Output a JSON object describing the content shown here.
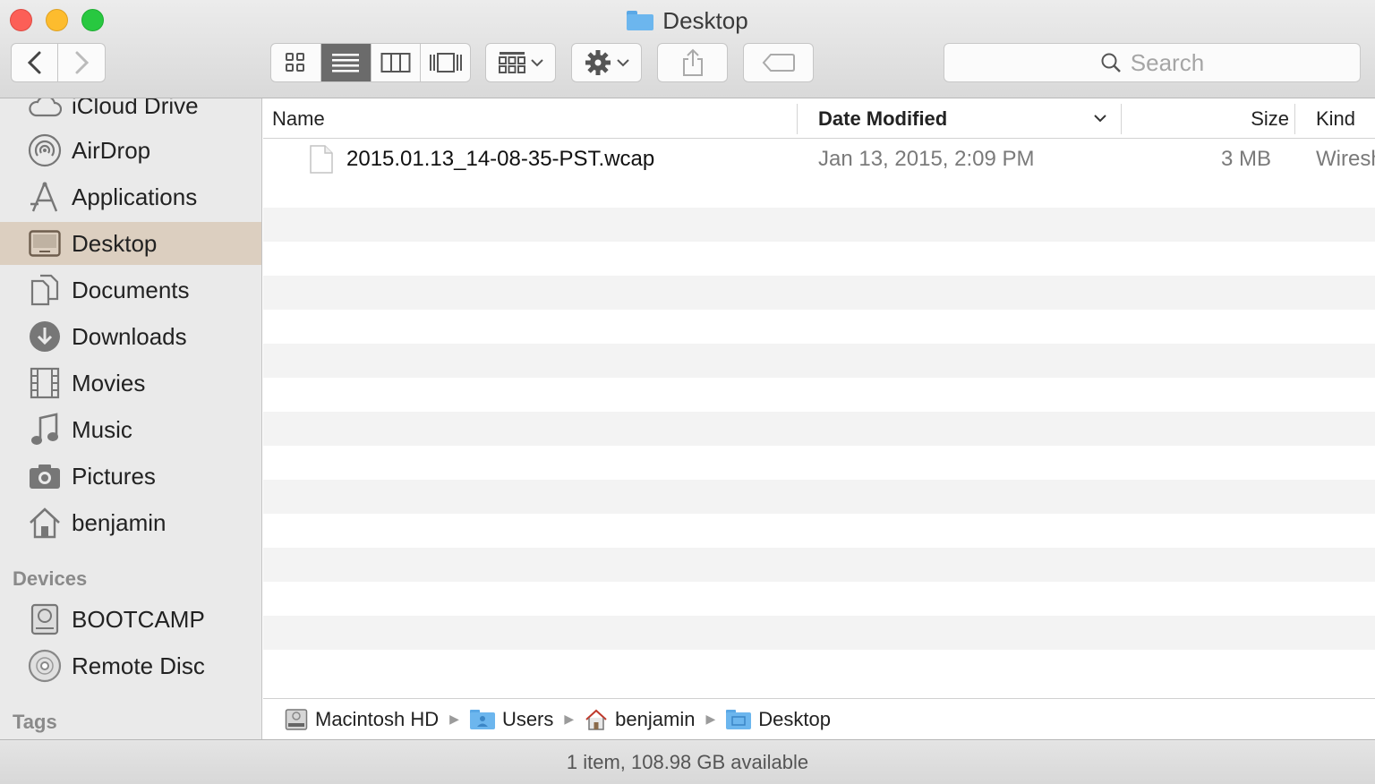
{
  "window": {
    "title": "Desktop"
  },
  "toolbar": {
    "search_placeholder": "Search"
  },
  "sidebar": {
    "items": [
      {
        "label": "iCloud Drive",
        "icon": "cloud-icon"
      },
      {
        "label": "AirDrop",
        "icon": "airdrop-icon"
      },
      {
        "label": "Applications",
        "icon": "applications-icon"
      },
      {
        "label": "Desktop",
        "icon": "desktop-icon",
        "selected": true
      },
      {
        "label": "Documents",
        "icon": "documents-icon"
      },
      {
        "label": "Downloads",
        "icon": "downloads-icon"
      },
      {
        "label": "Movies",
        "icon": "movies-icon"
      },
      {
        "label": "Music",
        "icon": "music-icon"
      },
      {
        "label": "Pictures",
        "icon": "pictures-icon"
      },
      {
        "label": "benjamin",
        "icon": "home-icon"
      }
    ],
    "devices_heading": "Devices",
    "devices": [
      {
        "label": "BOOTCAMP",
        "icon": "hard-drive-icon"
      },
      {
        "label": "Remote Disc",
        "icon": "disc-icon"
      }
    ],
    "tags_heading": "Tags"
  },
  "columns": {
    "name": "Name",
    "date_modified": "Date Modified",
    "size": "Size",
    "kind": "Kind"
  },
  "files": [
    {
      "name": "2015.01.13_14-08-35-PST.wcap",
      "date_modified": "Jan 13, 2015, 2:09 PM",
      "size": "3 MB",
      "kind": "Wiresh"
    }
  ],
  "pathbar": {
    "crumbs": [
      "Macintosh HD",
      "Users",
      "benjamin",
      "Desktop"
    ]
  },
  "status": {
    "text": "1 item, 108.98 GB available"
  },
  "colors": {
    "selection": "#dccfc0",
    "folder_blue": "#6cb6ee",
    "close": "#fc5f57",
    "minimize": "#fdbc2e",
    "zoom": "#28c840"
  }
}
